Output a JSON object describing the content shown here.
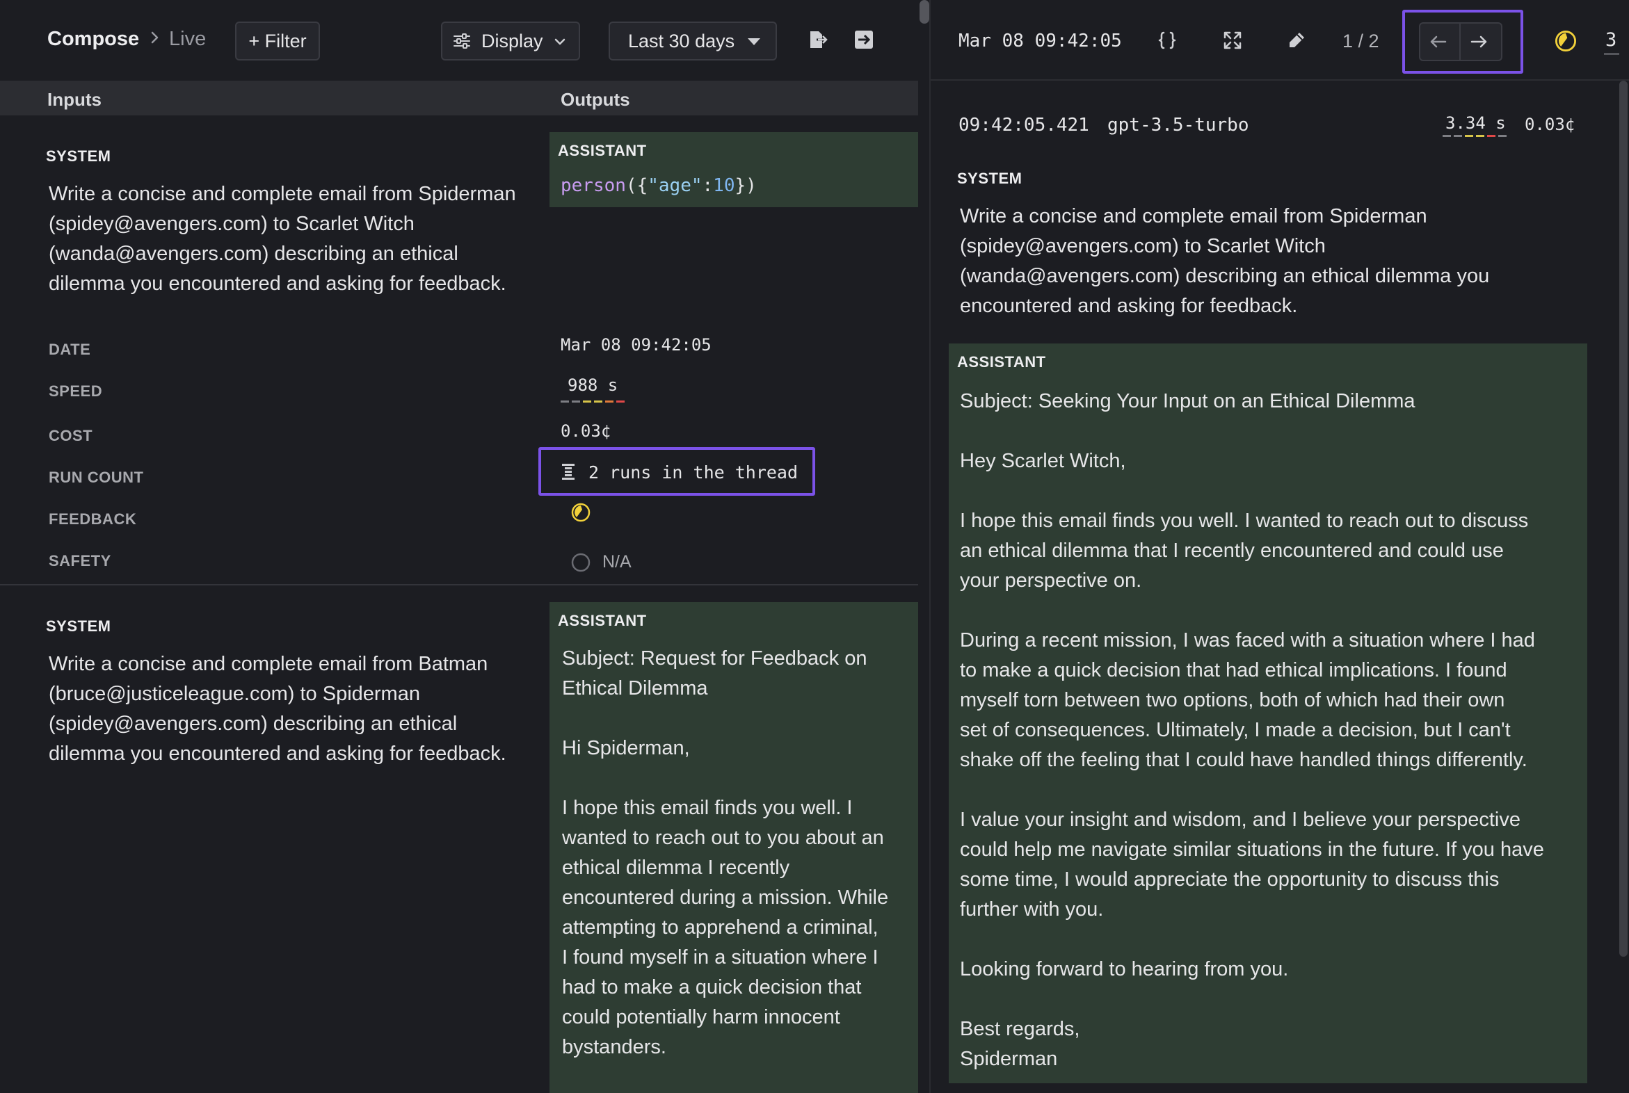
{
  "header": {
    "breadcrumb": [
      "Compose",
      "Live"
    ],
    "filter_label": "+ Filter",
    "display_label": "Display",
    "range_label": "Last 30 days",
    "icons": [
      "export-icon",
      "open-in-icon"
    ]
  },
  "columns": {
    "inputs": "Inputs",
    "outputs": "Outputs"
  },
  "rows": [
    {
      "system_label": "SYSTEM",
      "system_prompt": [
        "Write a concise and complete email from Spiderman",
        "(spidey@avengers.com) to Scarlet Witch",
        "(wanda@avengers.com) describing an ethical",
        "dilemma you encountered and asking for feedback."
      ],
      "assistant_label": "ASSISTANT",
      "assistant_fn": "person",
      "assistant_args": [
        "(",
        "{",
        "\"age\"",
        ":",
        "10",
        "}",
        ")"
      ],
      "meta": {
        "date_label": "DATE",
        "date": "Mar 08 09:42:05",
        "speed_label": "SPEED",
        "speed": "988 s",
        "cost_label": "COST",
        "cost": "0.03¢",
        "run_count_label": "RUN COUNT",
        "run_count": "2 runs in the thread",
        "feedback_label": "FEEDBACK",
        "safety_label": "SAFETY",
        "safety": "N/A"
      }
    },
    {
      "system_label": "SYSTEM",
      "system_prompt": [
        "Write a concise and complete email from Batman",
        "(bruce@justiceleague.com) to Spiderman",
        "(spidey@avengers.com) describing an ethical",
        "dilemma you encountered and asking for feedback."
      ],
      "assistant_label": "ASSISTANT",
      "assistant_text": [
        "Subject: Request for Feedback on",
        "Ethical Dilemma",
        "",
        "Hi Spiderman,",
        "",
        "I hope this email finds you well. I",
        "wanted to reach out to you about an",
        "ethical dilemma I recently",
        "encountered during a mission. While",
        "attempting to apprehend a criminal,",
        "I found myself in a situation where I",
        "had to make a quick decision that",
        "could potentially harm innocent",
        "bystanders."
      ]
    }
  ],
  "detail": {
    "date": "Mar 08 09:42:05",
    "pager": "1 / 2",
    "truncated": "3",
    "time": "09:42:05.421",
    "model": "gpt-3.5-turbo",
    "speed": "3.34 s",
    "cost": "0.03¢",
    "system_label": "SYSTEM",
    "system_prompt": [
      "Write a concise and complete email from Spiderman",
      "(spidey@avengers.com) to Scarlet Witch",
      "(wanda@avengers.com) describing an ethical dilemma you",
      "encountered and asking for feedback."
    ],
    "assistant_label": "ASSISTANT",
    "assistant_text": [
      "Subject: Seeking Your Input on an Ethical Dilemma",
      "",
      "Hey Scarlet Witch,",
      "",
      "I hope this email finds you well. I wanted to reach out to discuss",
      "an ethical dilemma that I recently encountered and could use",
      "your perspective on.",
      "",
      "During a recent mission, I was faced with a situation where I had",
      "to make a quick decision that had ethical implications. I found",
      "myself torn between two options, both of which had their own",
      "set of consequences. Ultimately, I made a decision, but I can't",
      "shake off the feeling that I could have handled things differently.",
      "",
      "I value your insight and wisdom, and I believe your perspective",
      "could help me navigate similar situations in the future. If you have",
      "some time, I would appreciate the opportunity to discuss this",
      "further with you.",
      "",
      "Looking forward to hearing from you.",
      "",
      "Best regards,",
      "Spiderman"
    ]
  },
  "colors": {
    "accent_highlight": "#7b52e8",
    "assistant_bg": "#2e3d33",
    "feedback_icon": "#f2d13a",
    "json_fn": "#c89cf0",
    "json_string": "#9ad0f2",
    "json_number": "#7fb6f0"
  }
}
